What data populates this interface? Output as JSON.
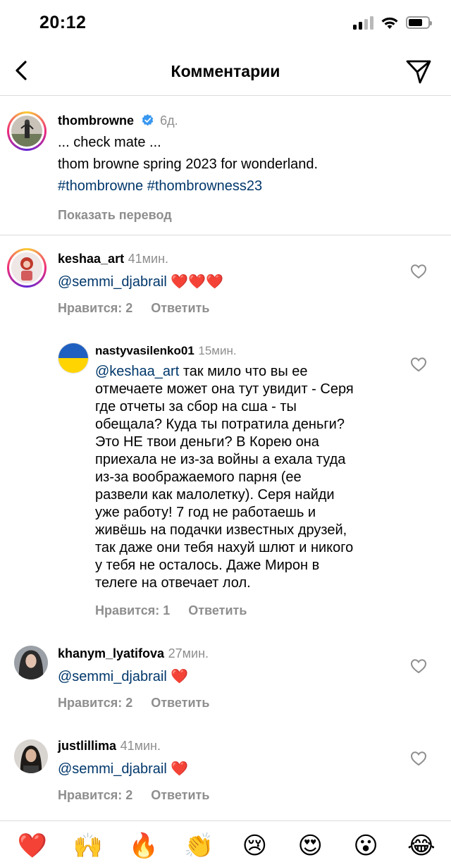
{
  "status": {
    "time": "20:12"
  },
  "header": {
    "title": "Комментарии"
  },
  "caption": {
    "username": "thombrowne",
    "time": "6д.",
    "line1": "... check mate ...",
    "line2": "thom browne spring 2023 for wonderland.",
    "hashtags": "#thombrowne #thombrowness23",
    "translate": "Показать перевод"
  },
  "comments": [
    {
      "username": "keshaa_art",
      "time": "41мин.",
      "mention": "@semmi_djabrail",
      "emoji": "❤️❤️❤️",
      "likes": "Нравится: 2",
      "reply": "Ответить"
    },
    {
      "username": "nastyvasilenko01",
      "time": "15мин.",
      "mention": "@keshaa_art",
      "lines": [
        " так мило что вы ее",
        "отмечаете может она тут увидит - Серя",
        "где отчеты за сбор на сша - ты",
        "обещала? Куда ты потратила деньги?",
        "Это НЕ твои деньги? В Корею она",
        "приехала не из-за войны а ехала туда",
        "из-за воображаемого парня (ее",
        "развели как малолетку). Серя найди",
        "уже работу! 7 год не работаешь и",
        "живёшь на подачки известных друзей,",
        "так даже они тебя нахуй шлют и никого",
        "у тебя не осталось. Даже Мирон в",
        "телеге на отвечает лол."
      ],
      "likes": "Нравится: 1",
      "reply": "Ответить"
    },
    {
      "username": "khanym_lyatifova",
      "time": "27мин.",
      "mention": "@semmi_djabrail",
      "emoji": "❤️",
      "likes": "Нравится: 2",
      "reply": "Ответить"
    },
    {
      "username": "justlillima",
      "time": "41мин.",
      "mention": "@semmi_djabrail",
      "emoji": "❤️",
      "likes": "Нравится: 2",
      "reply": "Ответить"
    }
  ],
  "emoji_bar": [
    "❤️",
    "🙌",
    "🔥",
    "👏",
    "😢",
    "😍",
    "😮",
    "😂"
  ],
  "colors": {
    "link": "#00376b",
    "muted": "#8e8e8e",
    "verified": "#3897f0",
    "heart": "#e0245e"
  }
}
